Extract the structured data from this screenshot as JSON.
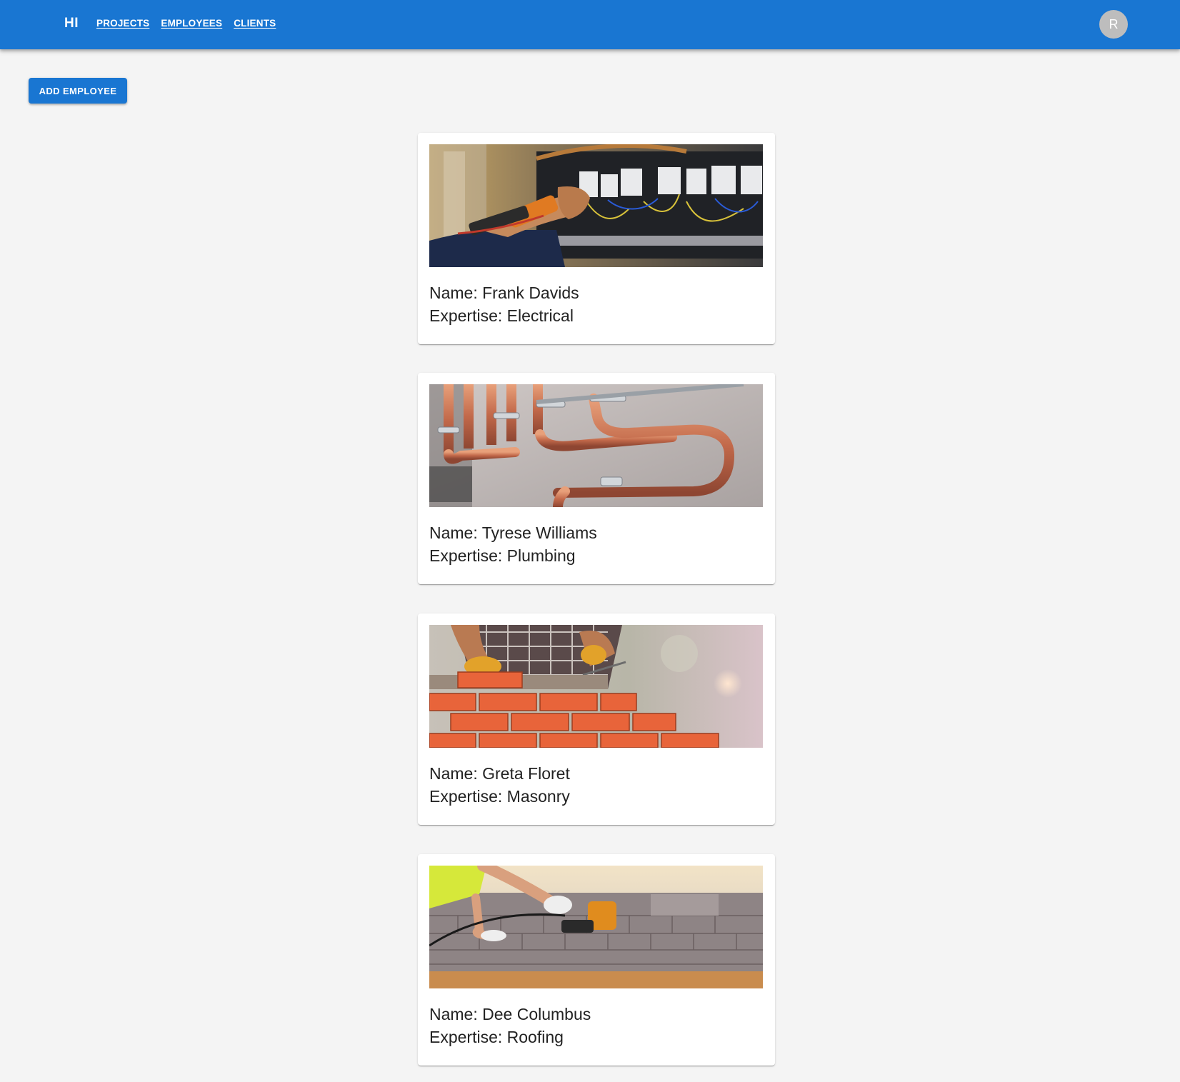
{
  "appbar": {
    "brand": "HI",
    "nav": [
      "PROJECTS",
      "EMPLOYEES",
      "CLIENTS"
    ],
    "avatar_initial": "R"
  },
  "toolbar": {
    "add_employee_label": "ADD EMPLOYEE"
  },
  "employees": [
    {
      "name_line": "Name: Frank Davids",
      "expertise_line": "Expertise: Electrical"
    },
    {
      "name_line": "Name: Tyrese Williams",
      "expertise_line": "Expertise: Plumbing"
    },
    {
      "name_line": "Name: Greta Floret",
      "expertise_line": "Expertise: Masonry"
    },
    {
      "name_line": "Name: Dee Columbus",
      "expertise_line": "Expertise: Roofing"
    }
  ],
  "colors": {
    "primary": "#1976d2",
    "background": "#f4f4f4",
    "avatar": "#bdbdbd"
  }
}
